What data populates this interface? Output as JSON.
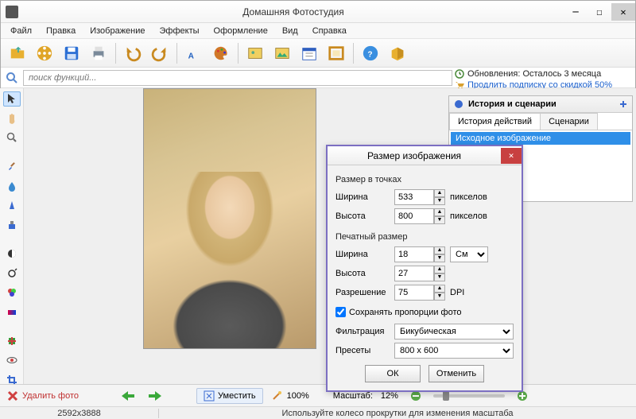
{
  "app": {
    "title": "Домашняя Фотостудия"
  },
  "menu": [
    "Файл",
    "Правка",
    "Изображение",
    "Эффекты",
    "Оформление",
    "Вид",
    "Справка"
  ],
  "search": {
    "placeholder": "поиск функций..."
  },
  "info": {
    "updates": "Обновления: Осталось  3 месяца",
    "extend": "Продлить подписку со скидкой 50%"
  },
  "history": {
    "title": "История и сценарии",
    "tab_actions": "История действий",
    "tab_scenarios": "Сценарии",
    "item0": "Исходное изображение"
  },
  "dialog": {
    "title": "Размер изображения",
    "sec_px": "Размер в точках",
    "width_label": "Ширина",
    "width_val": "533",
    "height_label": "Высота",
    "height_val": "800",
    "px_unit": "пикселов",
    "sec_print": "Печатный размер",
    "pwidth_val": "18",
    "pheight_val": "27",
    "cm_unit": "См",
    "res_label": "Разрешение",
    "res_val": "75",
    "dpi": "DPI",
    "keep_ratio": "Сохранять пропорции фото",
    "filter_label": "Фильтрация",
    "filter_val": "Бикубическая",
    "preset_label": "Пресеты",
    "preset_val": "800 x 600",
    "ok": "ОК",
    "cancel": "Отменить"
  },
  "bottom": {
    "delete": "Удалить фото",
    "fit": "Уместить",
    "hundred": "100%",
    "scale_label": "Масштаб:",
    "scale_val": "12%"
  },
  "status": {
    "dims": "2592x3888",
    "hint": "Используйте колесо прокрутки для изменения масштаба"
  }
}
